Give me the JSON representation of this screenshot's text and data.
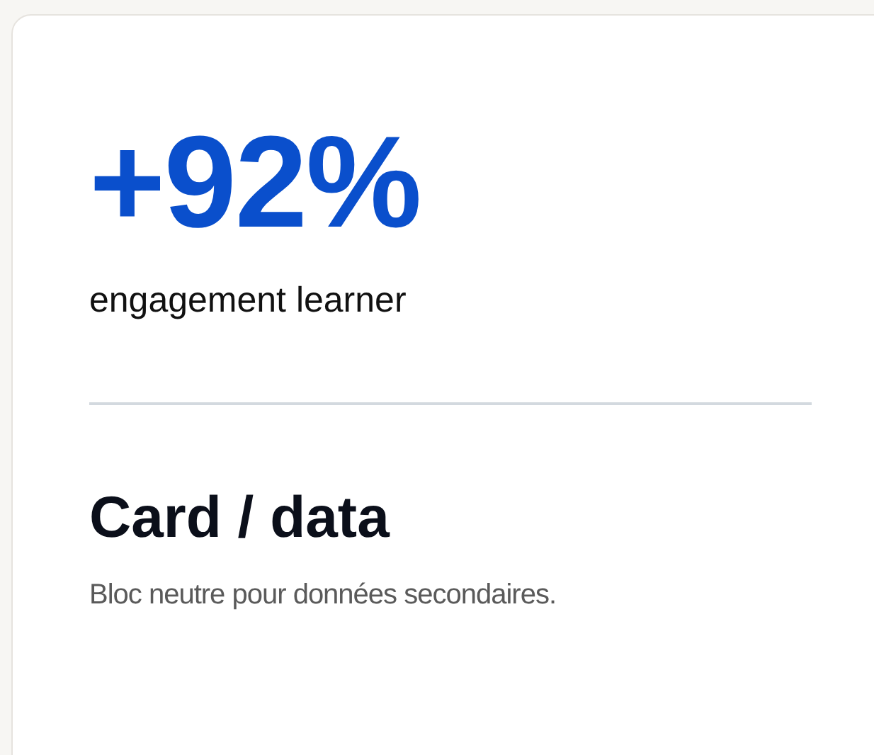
{
  "metric": {
    "value": "+92%",
    "label": "engagement learner"
  },
  "card": {
    "title": "Card / data",
    "description": "Bloc neutre pour données secondaires."
  }
}
